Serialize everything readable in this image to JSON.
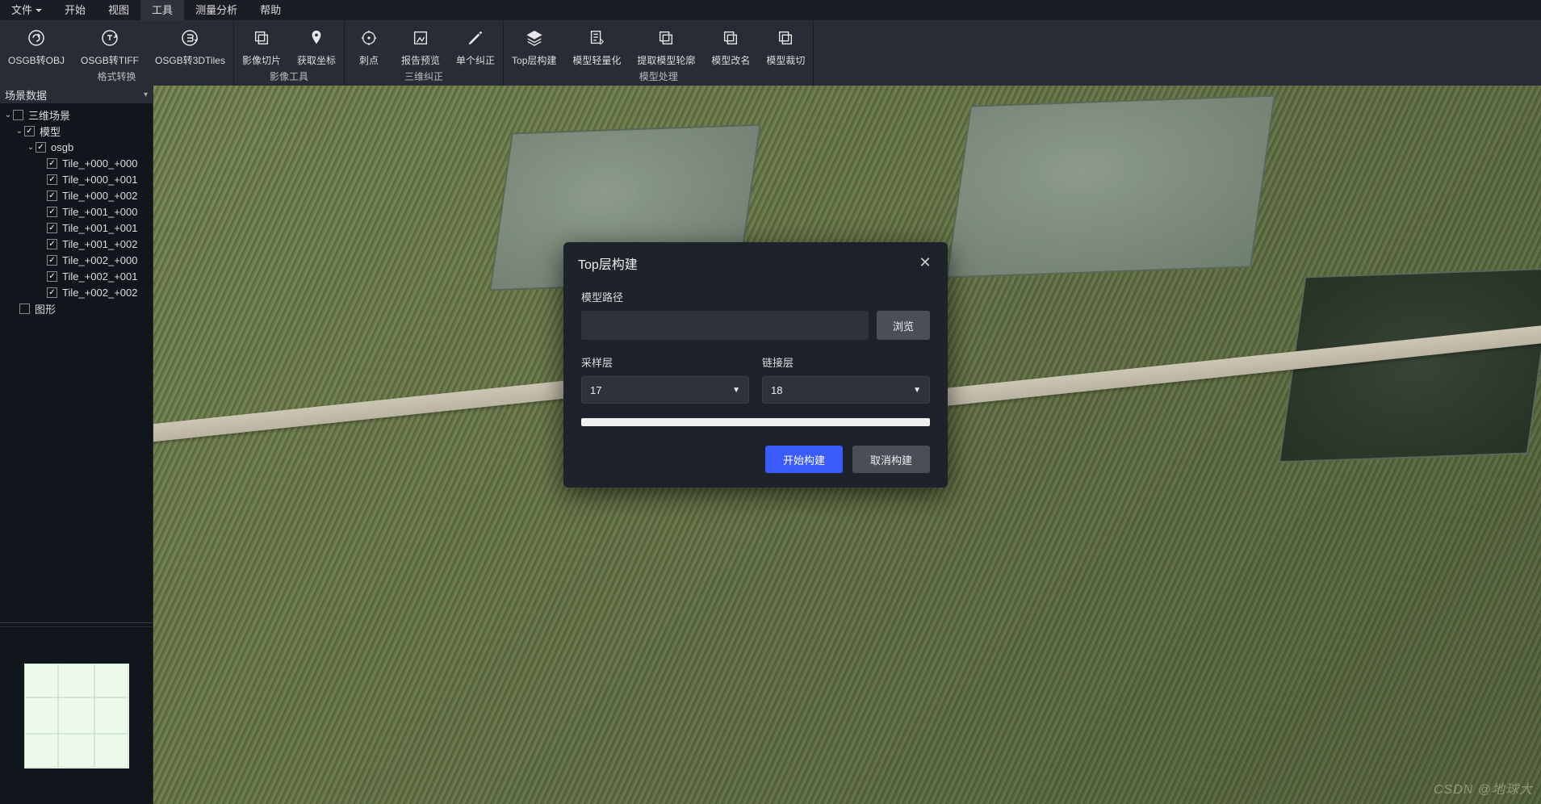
{
  "menubar": {
    "file": "文件",
    "items": [
      "开始",
      "视图",
      "工具",
      "测量分析",
      "帮助"
    ],
    "activeIndex": 2
  },
  "ribbon": {
    "groups": [
      {
        "label": "格式转换",
        "buttons": [
          {
            "icon": "convert-c-icon",
            "label": "OSGB转OBJ"
          },
          {
            "icon": "convert-t-icon",
            "label": "OSGB转TIFF"
          },
          {
            "icon": "convert-e-icon",
            "label": "OSGB转3DTiles"
          }
        ]
      },
      {
        "label": "影像工具",
        "buttons": [
          {
            "icon": "image-slice-icon",
            "label": "影像切片"
          },
          {
            "icon": "get-coord-icon",
            "label": "获取坐标"
          }
        ]
      },
      {
        "label": "三维纠正",
        "buttons": [
          {
            "icon": "target-icon",
            "label": "刺点"
          },
          {
            "icon": "report-icon",
            "label": "报告预览"
          },
          {
            "icon": "correct-icon",
            "label": "单个纠正"
          }
        ]
      },
      {
        "label": "模型处理",
        "buttons": [
          {
            "icon": "layers-icon",
            "label": "Top层构建"
          },
          {
            "icon": "lightweight-icon",
            "label": "模型轻量化"
          },
          {
            "icon": "outline-icon",
            "label": "提取模型轮廓"
          },
          {
            "icon": "rename-icon",
            "label": "模型改名"
          },
          {
            "icon": "crop-icon",
            "label": "模型裁切"
          }
        ]
      }
    ]
  },
  "sidebar": {
    "panelTitle": "场景数据",
    "tree": {
      "root": "三维场景",
      "model": "模型",
      "group": "osgb",
      "tiles": [
        "Tile_+000_+000",
        "Tile_+000_+001",
        "Tile_+000_+002",
        "Tile_+001_+000",
        "Tile_+001_+001",
        "Tile_+001_+002",
        "Tile_+002_+000",
        "Tile_+002_+001",
        "Tile_+002_+002"
      ],
      "shapes": "图形"
    }
  },
  "modal": {
    "title": "Top层构建",
    "pathLabel": "模型路径",
    "pathValue": "",
    "browse": "浏览",
    "sampleLabel": "采样层",
    "sampleValue": "17",
    "linkLabel": "链接层",
    "linkValue": "18",
    "start": "开始构建",
    "cancel": "取消构建"
  },
  "watermark": "CSDN @地球大"
}
